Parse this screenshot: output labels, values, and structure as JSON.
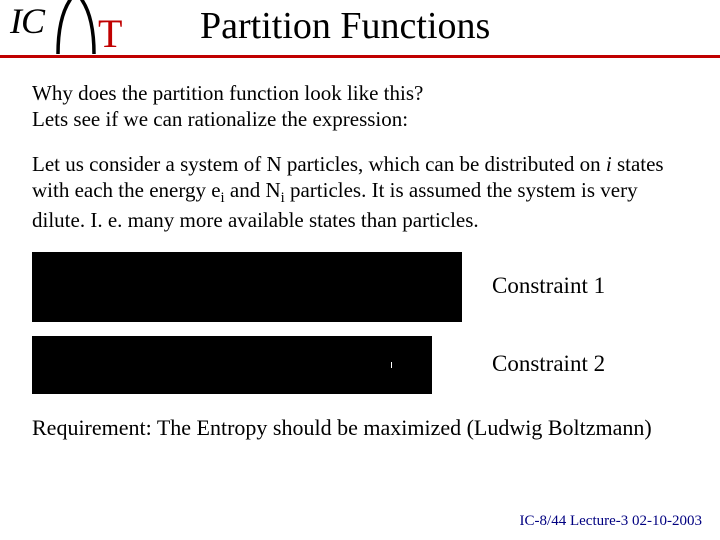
{
  "header": {
    "logo_ic": "IC",
    "logo_t": "T",
    "title": "Partition Functions"
  },
  "body": {
    "intro_line1": "Why does the partition function look like this?",
    "intro_line2": "Lets see if we can rationalize the expression:",
    "para2_part1": "Let us consider a system of N particles, which can be distributed on ",
    "para2_i": "i",
    "para2_part2": " states with each the energy e",
    "para2_sub1": "i",
    "para2_part3": " and N",
    "para2_sub2": "i",
    "para2_part4": " particles. It is assumed the system is very dilute. I. e. many more available states than particles.",
    "constraint1": "Constraint 1",
    "constraint2": "Constraint 2",
    "requirement": "Requirement: The Entropy should be maximized (Ludwig Boltzmann)"
  },
  "footer": {
    "text": "IC-8/44  Lecture-3 02-10-2003"
  }
}
